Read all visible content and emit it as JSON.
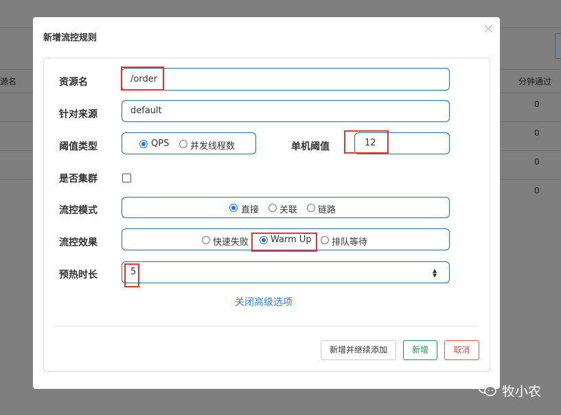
{
  "background": {
    "col_resource_name": "源名",
    "col_pass_per_min": "分钟通过",
    "row_values": [
      "0",
      "0",
      "0",
      "0"
    ]
  },
  "modal": {
    "title": "新增流控规则",
    "close_symbol": "×",
    "fields": {
      "resource_label": "资源名",
      "resource_value": "/order",
      "limit_app_label": "针对来源",
      "limit_app_value": "default",
      "grade_label": "阈值类型",
      "grade_options": [
        "QPS",
        "并发线程数"
      ],
      "grade_selected": "QPS",
      "count_label": "单机阈值",
      "count_value": "12",
      "cluster_label": "是否集群",
      "cluster_checked": false,
      "strategy_label": "流控模式",
      "strategy_options": [
        "直接",
        "关联",
        "链路"
      ],
      "strategy_selected": "直接",
      "behavior_label": "流控效果",
      "behavior_options": [
        "快速失败",
        "Warm Up",
        "排队等待"
      ],
      "behavior_selected": "Warm Up",
      "warmup_label": "预热时长",
      "warmup_value": "5"
    },
    "advanced_link": "关闭高级选项",
    "buttons": {
      "add_continue": "新增并继续添加",
      "add": "新增",
      "cancel": "取消"
    }
  },
  "watermark": {
    "text": "牧小农"
  },
  "colors": {
    "accent": "#1a73e8",
    "highlight": "#e8322d",
    "success": "#2e8b57",
    "danger": "#d9534f",
    "link": "#3a7fc5"
  }
}
